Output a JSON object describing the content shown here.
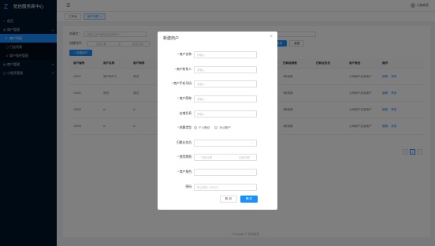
{
  "app": {
    "title": "驼信服务商中心"
  },
  "sidebar": {
    "items": [
      {
        "label": "首页",
        "icon": "home-icon"
      },
      {
        "label": "商户管理",
        "icon": "shop-icon",
        "expanded": true,
        "children": [
          {
            "label": "商户列表",
            "icon": "list-icon",
            "active": true
          },
          {
            "label": "门店列表",
            "icon": "store-icon"
          },
          {
            "label": "商户角色管理",
            "icon": "role-icon"
          }
        ]
      },
      {
        "label": "商户管理",
        "icon": "shop-icon"
      },
      {
        "label": "小程序管理",
        "icon": "app-icon"
      }
    ]
  },
  "header": {
    "user": "小陈商家"
  },
  "tabs": [
    {
      "label": "工作台"
    },
    {
      "label": "商户列表",
      "active": true
    }
  ],
  "filters": {
    "merchant_label": "关键字：",
    "merchant_placeholder": "请输入商户编号/名称/联系人",
    "status_label": "状态：",
    "status_value": "全部",
    "date_label": "创建时间：",
    "date_start": "开始日期",
    "date_to": "至",
    "date_end": "结束日期",
    "search_label": "查询",
    "reset_label": "重置",
    "new_label": "+ 新建商户"
  },
  "table": {
    "columns": [
      "商户编号",
      "商户名称",
      "商户简称",
      "",
      "",
      "",
      "门店数量",
      "扫码收款数",
      "扫码业务员",
      "商户角色",
      "操作"
    ],
    "rows": [
      [
        "10001",
        "商户商户A",
        "测试",
        "",
        "",
        "",
        "1",
        "0条收款",
        "",
        "公司商户实名商户",
        "编辑 禁用"
      ],
      [
        "10002",
        "测试",
        "测试",
        "",
        "",
        "",
        "1",
        "0条收款",
        "",
        "公司商户实名商户",
        "编辑 禁用"
      ],
      [
        "10003",
        "ni",
        "ni",
        "",
        "",
        "",
        "1",
        "0条收款",
        "",
        "公司商户实名商户",
        "编辑 禁用"
      ],
      [
        "10005",
        "w",
        "w",
        "",
        "",
        "",
        "1",
        "0条收款",
        "",
        "公司商户实名商户",
        "编辑 禁用"
      ]
    ],
    "edit_label": "编辑",
    "disable_label": "禁用"
  },
  "pager": {
    "prev": "‹",
    "page": "1",
    "next": "›"
  },
  "footer": {
    "text": "Copyright © 驼信服务"
  },
  "modal": {
    "title": "新建商户",
    "fields": {
      "name": {
        "label": "商户名称:",
        "placeholder": "请输入"
      },
      "contact": {
        "label": "商户联系人:",
        "placeholder": "请输入"
      },
      "phone": {
        "label": "商户手机号码:",
        "placeholder": "请输入"
      },
      "short_name": {
        "label": "商户简称:",
        "placeholder": "请输入"
      },
      "manager": {
        "label": "店铺负责:",
        "placeholder": "请输入"
      },
      "settle": {
        "label": "结算类型:",
        "options": [
          "个人借记",
          "对公账户"
        ]
      },
      "salesman": {
        "label": "归属业务员:",
        "placeholder": ""
      },
      "period": {
        "label": "使用期限:",
        "start": "开始日期",
        "to": "-",
        "end": "结束日期"
      },
      "role": {
        "label": "商户角色:",
        "placeholder": ""
      },
      "password": {
        "label": "密码:",
        "placeholder": "默认密码: 000000"
      }
    },
    "cancel_label": "取 消",
    "confirm_label": "确 定"
  },
  "colors": {
    "primary": "#1890ff",
    "sidebar_bg": "#001529",
    "required": "#f5222d"
  }
}
